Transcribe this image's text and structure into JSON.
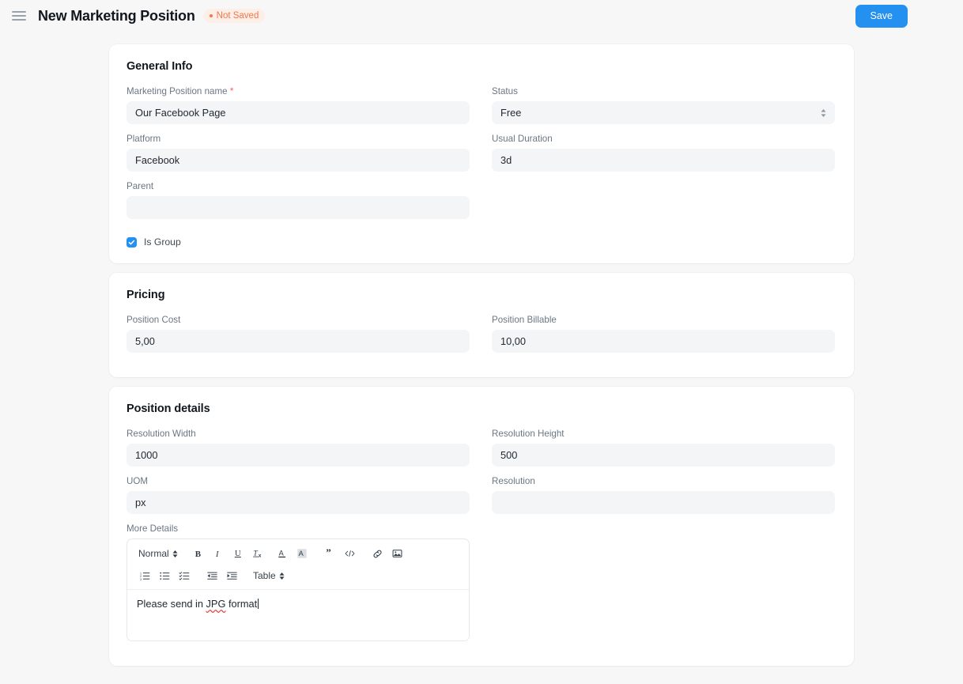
{
  "header": {
    "menu_icon": "hamburger-menu-icon",
    "title": "New Marketing Position",
    "status_badge": "Not Saved",
    "save_label": "Save",
    "accent_color": "#2490ef",
    "badge_color": "#f2784b",
    "badge_bg": "#fdeee7"
  },
  "sections": {
    "general": {
      "title": "General Info",
      "fields": {
        "name_label": "Marketing Position name",
        "name_required": "*",
        "name_value": "Our Facebook Page",
        "status_label": "Status",
        "status_value": "Free",
        "platform_label": "Platform",
        "platform_value": "Facebook",
        "duration_label": "Usual Duration",
        "duration_value": "3d",
        "parent_label": "Parent",
        "parent_value": "",
        "is_group_label": "Is Group",
        "is_group_checked": true
      }
    },
    "pricing": {
      "title": "Pricing",
      "fields": {
        "cost_label": "Position Cost",
        "cost_value": "5,00",
        "billable_label": "Position Billable",
        "billable_value": "10,00"
      }
    },
    "details": {
      "title": "Position details",
      "fields": {
        "res_width_label": "Resolution Width",
        "res_width_value": "1000",
        "res_height_label": "Resolution Height",
        "res_height_value": "500",
        "uom_label": "UOM",
        "uom_value": "px",
        "resolution_label": "Resolution",
        "resolution_value": "",
        "more_details_label": "More Details"
      },
      "editor": {
        "format_label": "Normal",
        "table_label": "Table",
        "content_prefix": "Please send in ",
        "content_misspelled": "JPG",
        "content_suffix": " format",
        "toolbar_row1": [
          "bold-icon",
          "italic-icon",
          "underline-icon",
          "clear-format-icon",
          "font-color-icon",
          "background-color-icon",
          "blockquote-icon",
          "code-icon",
          "link-icon",
          "image-icon"
        ],
        "toolbar_row2": [
          "ordered-list-icon",
          "bullet-list-icon",
          "check-list-icon",
          "outdent-icon",
          "indent-icon"
        ]
      }
    }
  }
}
